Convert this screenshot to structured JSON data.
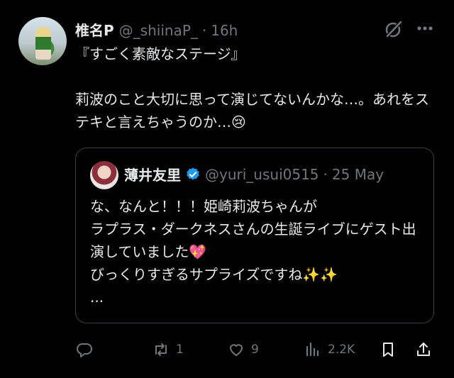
{
  "post": {
    "author_name": "椎名P",
    "author_handle": "@_shiinaP_",
    "separator": "·",
    "time": "16h",
    "text": "『すごく素敵なステージ』\n\n莉波のこと大切に思って演じてないんかな…。あれをステキと言えちゃうのか…😢"
  },
  "quote": {
    "author_name": "薄井友里",
    "author_handle": "@yuri_usui0515",
    "separator": "·",
    "time": "25 May",
    "text": "な、なんと！！！姫崎莉波ちゃんが\nラプラス・ダークネスさんの生誕ライブにゲスト出演していました💖\nびっくりすぎるサプライズですね✨✨\n..."
  },
  "actions": {
    "reply_count": "",
    "retweet_count": "1",
    "like_count": "9",
    "views_count": "2.2K"
  },
  "colors": {
    "background": "#000000",
    "text": "#e7e9ea",
    "muted": "#71767b",
    "verified": "#1d9bf0",
    "border": "#3a3d41"
  },
  "icons": [
    "grok-icon",
    "more-icon",
    "verified-icon",
    "reply-icon",
    "retweet-icon",
    "like-icon",
    "views-icon",
    "bookmark-icon",
    "share-icon"
  ]
}
